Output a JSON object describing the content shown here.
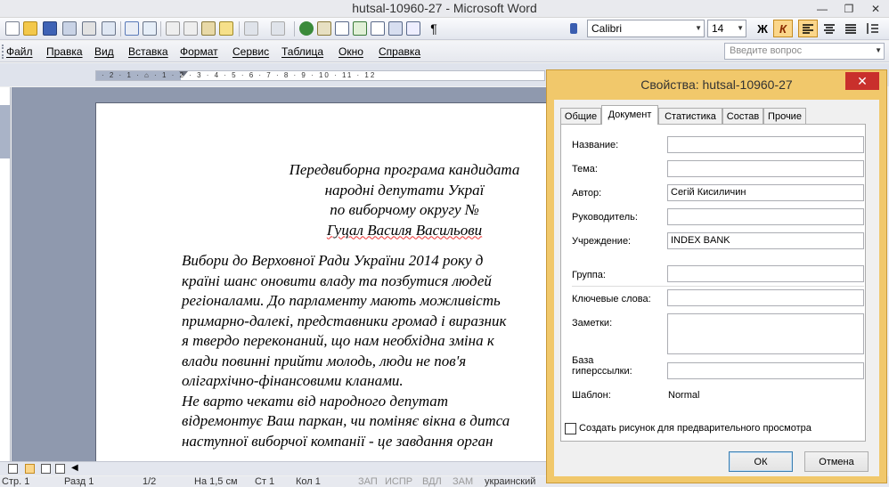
{
  "window": {
    "title": "hutsal-10960-27 - Microsoft Word",
    "minimize_glyph": "—",
    "maximize_glyph": "❐",
    "close_glyph": "✕"
  },
  "toolbar": {
    "font_name": "Calibri",
    "font_size": "14",
    "bold_label": "Ж",
    "italic_label": "К",
    "paragraph_mark": "¶"
  },
  "menu": {
    "items": [
      "Файл",
      "Правка",
      "Вид",
      "Вставка",
      "Формат",
      "Сервис",
      "Таблица",
      "Окно",
      "Справка"
    ],
    "help_placeholder": "Введите вопрос"
  },
  "ruler": {
    "text": "· 2 · 1 · ⌂ · 1 · 2 · 3 · 4 · 5 · 6 · 7 · 8 · 9 · 10 · 11 · 12"
  },
  "document": {
    "heading_lines": [
      "Передвиборна програма кандидата",
      "народні депутати Украї",
      "по виборчому округу №",
      "Гуцал Василя Васильови"
    ],
    "paragraph1": [
      "      Вибори до Верховної Ради України 2014 року д",
      "країні шанс оновити владу та позбутися людей",
      "регіоналами. До парламенту мають можливість",
      "примарно-далекі, представники громад і виразник",
      "я твердо переконаний, що нам необхідна зміна к",
      "влади повинні прийти молодь, люди не пов'я",
      "олігархічно-фінансовими кланами."
    ],
    "paragraph2": [
      "      Не варто чекати від народного депутат",
      "відремонтує Ваш паркан, чи поміняє вікна в дитса",
      "наступної виборчої компанії - це завдання орган"
    ]
  },
  "statusbar": {
    "page": "Стр. 1",
    "section": "Разд 1",
    "pages": "1/2",
    "position": "На 1,5 см",
    "line": "Ст 1",
    "column": "Кол 1",
    "rec": "ЗАП",
    "trk": "ИСПР",
    "ext": "ВДЛ",
    "ovr": "ЗАМ",
    "language": "украинский"
  },
  "dialog": {
    "title": "Свойства: hutsal-10960-27",
    "tabs": [
      "Общие",
      "Документ",
      "Статистика",
      "Состав",
      "Прочие"
    ],
    "selected_tab": "Документ",
    "fields": {
      "title_label": "Название:",
      "title_value": "",
      "subject_label": "Тема:",
      "subject_value": "",
      "author_label": "Автор:",
      "author_value": "Сегій Кисиличин",
      "manager_label": "Руководитель:",
      "manager_value": "",
      "company_label": "Учреждение:",
      "company_value": "INDEX BANK",
      "category_label": "Группа:",
      "category_value": "",
      "keywords_label": "Ключевые слова:",
      "keywords_value": "",
      "comments_label": "Заметки:",
      "comments_value": "",
      "hyperlink_label_1": "База",
      "hyperlink_label_2": "гиперссылки:",
      "hyperlink_value": "",
      "template_label": "Шаблон:",
      "template_value": "Normal"
    },
    "preview_checkbox_label": "Создать рисунок для предварительного просмотра",
    "preview_checked": false,
    "ok_label": "ОК",
    "cancel_label": "Отмена"
  },
  "colors": {
    "dialog_frame": "#f1c86b",
    "close_button": "#c9302c",
    "active_format_button": "#fbd68a"
  }
}
